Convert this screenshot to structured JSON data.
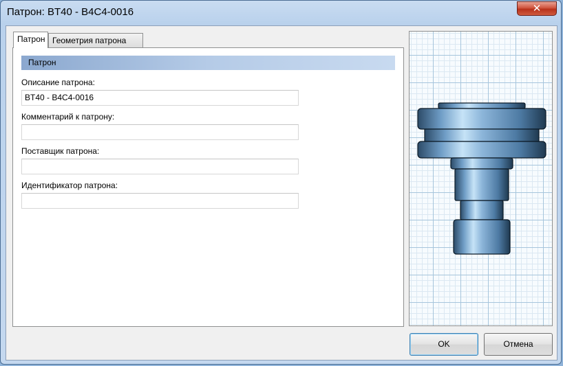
{
  "window": {
    "title": "Патрон: BT40 - B4C4-0016",
    "close_symbol": "✕"
  },
  "tabs": [
    {
      "label": "Патрон",
      "active": true
    },
    {
      "label": "Геометрия патрона",
      "active": false
    }
  ],
  "section": {
    "title": "Патрон"
  },
  "fields": [
    {
      "label": "Описание патрона:",
      "value": "BT40 - B4C4-0016"
    },
    {
      "label": "Комментарий к патрону:",
      "value": ""
    },
    {
      "label": "Поставщик патрона:",
      "value": ""
    },
    {
      "label": "Идентификатор патрона:",
      "value": ""
    }
  ],
  "buttons": {
    "ok": "OK",
    "cancel": "Отмена"
  },
  "preview": {
    "icon": "tool-holder-3d-icon",
    "grid_color": "#a6c5dc",
    "body_color": "#5f8db5"
  }
}
